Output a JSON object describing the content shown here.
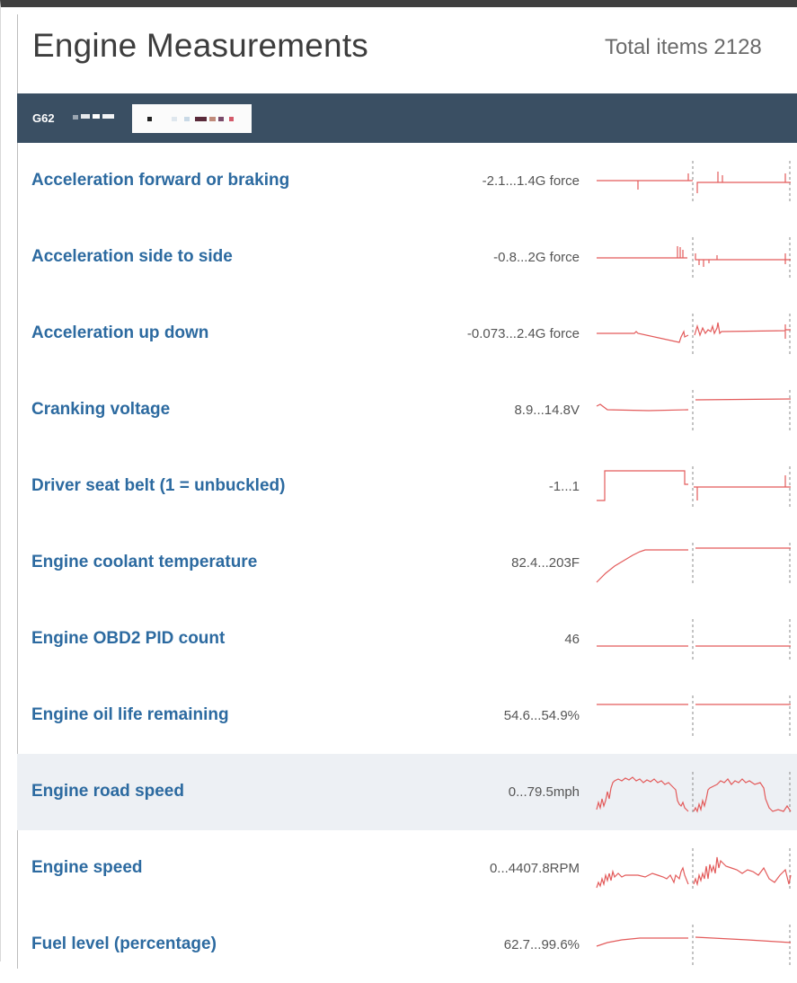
{
  "page": {
    "title": "Engine Measurements",
    "total_items": "Total items 2128"
  },
  "vehicle": {
    "id_prefix": "G62"
  },
  "colors": {
    "link": "#2c6aa0",
    "bar": "#3a4f63",
    "trace": "#e35b5b",
    "highlight": "#edf0f4"
  },
  "measurements": [
    {
      "name": "Acceleration forward or braking",
      "range": "-2.1...1.4G force",
      "spark": "accel_fwd"
    },
    {
      "name": "Acceleration side to side",
      "range": "-0.8...2G force",
      "spark": "accel_side"
    },
    {
      "name": "Acceleration up down",
      "range": "-0.073...2.4G force",
      "spark": "accel_up"
    },
    {
      "name": "Cranking voltage",
      "range": "8.9...14.8V",
      "spark": "cranking"
    },
    {
      "name": "Driver seat belt (1 = unbuckled)",
      "range": "-1...1",
      "spark": "seatbelt"
    },
    {
      "name": "Engine coolant temperature",
      "range": "82.4...203F",
      "spark": "coolant"
    },
    {
      "name": "Engine OBD2 PID count",
      "range": "46",
      "spark": "pid"
    },
    {
      "name": "Engine oil life remaining",
      "range": "54.6...54.9%",
      "spark": "oil"
    },
    {
      "name": "Engine road speed",
      "range": "0...79.5mph",
      "spark": "road_speed",
      "highlighted": true
    },
    {
      "name": "Engine speed",
      "range": "0...4407.8RPM",
      "spark": "rpm"
    },
    {
      "name": "Fuel level (percentage)",
      "range": "62.7...99.6%",
      "spark": "fuel"
    }
  ]
}
